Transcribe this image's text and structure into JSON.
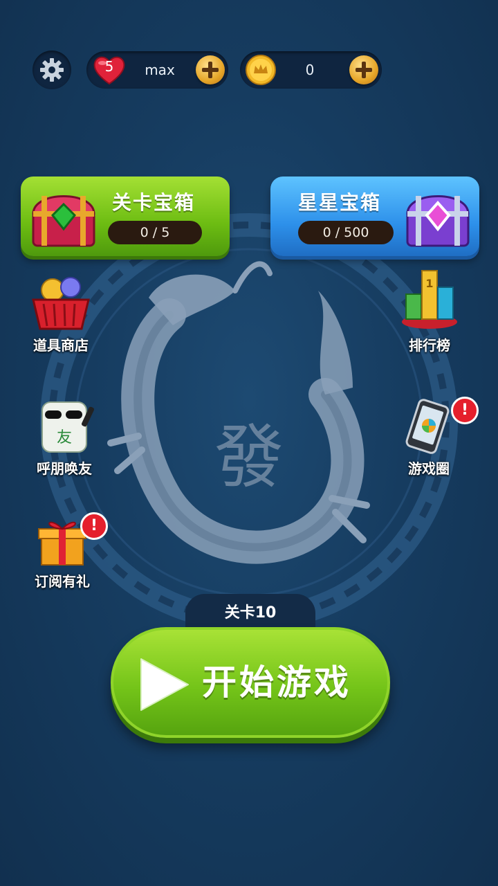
{
  "top_bar": {
    "lives": {
      "count": "5",
      "label": "max"
    },
    "coins": {
      "amount": "0"
    }
  },
  "chests": {
    "level_chest": {
      "title": "关卡宝箱",
      "progress": "0 / 5"
    },
    "star_chest": {
      "title": "星星宝箱",
      "progress": "0 / 500"
    }
  },
  "side_menu": {
    "shop": {
      "label": "道具商店",
      "icon": "shop-basket-icon"
    },
    "invite": {
      "label": "呼朋唤友",
      "icon": "panda-friend-icon"
    },
    "subscribe": {
      "label": "订阅有礼",
      "icon": "gift-box-icon",
      "badge": "!"
    },
    "leaderboard": {
      "label": "排行榜",
      "icon": "trophy-podium-icon"
    },
    "game_circle": {
      "label": "游戏圈",
      "icon": "phone-circle-icon",
      "badge": "!"
    }
  },
  "emblem": {
    "character": "發"
  },
  "level": {
    "label": "关卡10"
  },
  "play_button": {
    "label": "开始游戏"
  },
  "colors": {
    "accent_green": "#74c419",
    "accent_blue": "#2d90ea",
    "coin_gold": "#e5a528",
    "badge_red": "#e51f2c"
  }
}
